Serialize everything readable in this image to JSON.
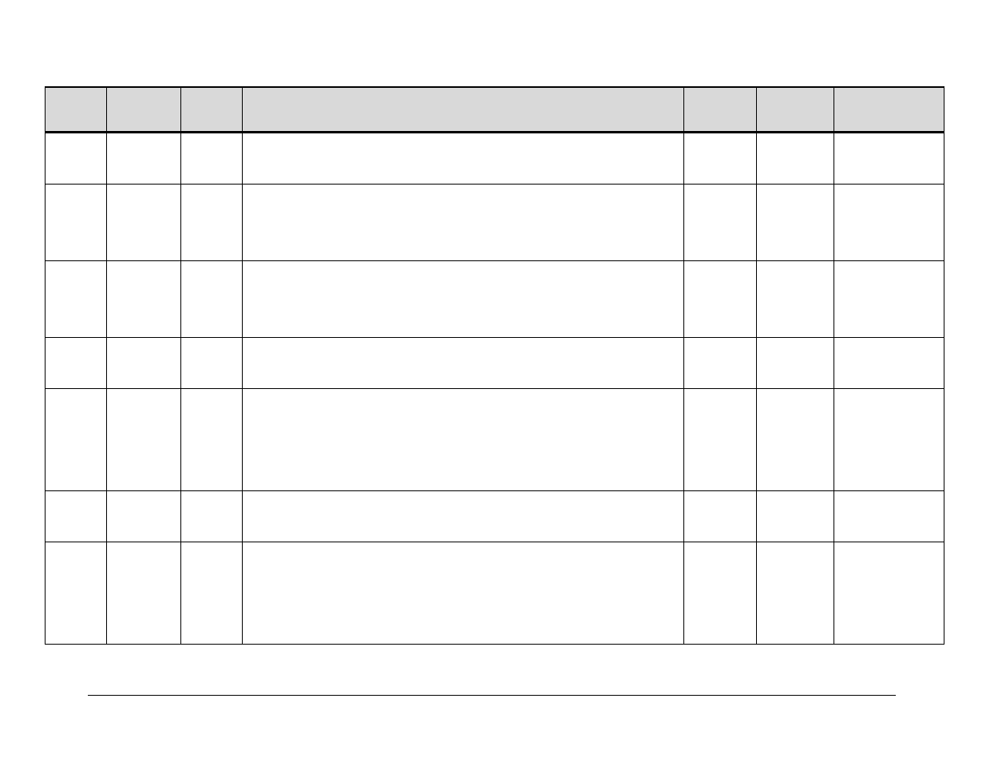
{
  "table": {
    "headers": [
      "",
      "",
      "",
      "",
      "",
      "",
      ""
    ],
    "rows": [
      {
        "cells": [
          "",
          "",
          "",
          "",
          "",
          "",
          ""
        ]
      },
      {
        "cells": [
          "",
          "",
          "",
          "",
          "",
          "",
          ""
        ]
      },
      {
        "cells": [
          "",
          "",
          "",
          "",
          "",
          "",
          ""
        ]
      },
      {
        "cells": [
          "",
          "",
          "",
          "",
          "",
          "",
          ""
        ]
      },
      {
        "cells": [
          "",
          "",
          "",
          "",
          "",
          "",
          ""
        ]
      },
      {
        "cells": [
          "",
          "",
          "",
          "",
          "",
          "",
          ""
        ]
      },
      {
        "cells": [
          "",
          "",
          "",
          "",
          "",
          "",
          ""
        ]
      }
    ]
  }
}
